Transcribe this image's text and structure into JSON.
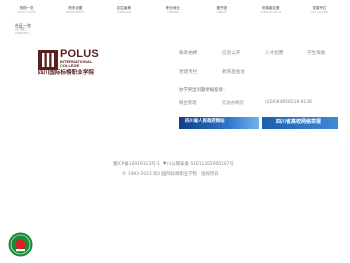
{
  "top_nav": [
    {
      "cn": "柏棉一览",
      "en": "ABOUT POLUS"
    },
    {
      "cn": "院系设置",
      "en": "DEPARTMENTS"
    },
    {
      "cn": "招生聚焦",
      "en": "ADMISSION"
    },
    {
      "cn": "职业就业",
      "en": "CAREERS"
    },
    {
      "cn": "图书馆",
      "en": "LIBRARY"
    },
    {
      "cn": "柏棉朋友圈",
      "en": "CONTACT POLUS"
    },
    {
      "cn": "党建专栏",
      "en": "CPC COLUMN"
    }
  ],
  "active_sub": {
    "cn": "社区一览",
    "sub": "关于我们",
    "en": "COMMUNITY"
  },
  "logo": {
    "name": "POLUS",
    "line1": "INTERNATIONAL",
    "line2": "COLLEGE",
    "cn_name": "四川国际标榜职业学院"
  },
  "quick_links": [
    "联系柏棉",
    "信息公开",
    "人才招聘",
    "学生资助",
    "党建专栏",
    "教育基金会"
  ],
  "report": {
    "title": "办学突出问题举报投诉：",
    "phone_label": "网台受理",
    "letters_label": "信访办网页",
    "number": "(028)84856519-8136"
  },
  "banners": {
    "left": "四川省人民政府网站",
    "right": "四川省高校网络举报"
  },
  "footer": {
    "icp": "蜀ICP备10019113号-1",
    "police": "川公网安备 51011202000167号",
    "copyright": "© 1993-2023 四川国际标榜职业学院 · 版权所有"
  },
  "colors": {
    "brand": "#5a1e1e",
    "banner_blue": "#1f5fb3",
    "seal_green": "#1c8a3a",
    "seal_red": "#d82020"
  }
}
